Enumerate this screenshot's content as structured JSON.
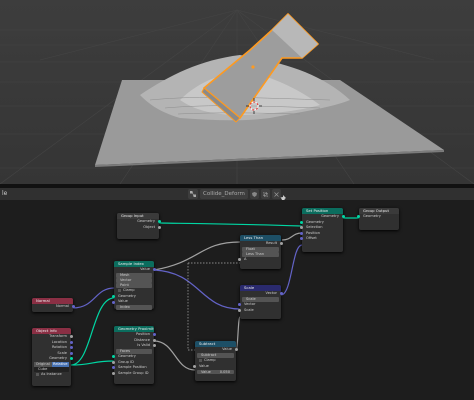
{
  "header": {
    "editor_label": "le",
    "node_group_name": "Collide_Deform"
  },
  "nodes": {
    "group_input": {
      "title": "Group Input",
      "geometry": "Geometry",
      "object": "Object"
    },
    "set_position": {
      "title": "Set Position",
      "geometry_out": "Geometry",
      "geometry_in": "Geometry",
      "selection": "Selection",
      "position": "Position",
      "offset": "Offset"
    },
    "group_output": {
      "title": "Group Output",
      "geometry": "Geometry"
    },
    "less_than": {
      "title": "Less Than",
      "result": "Result",
      "type": "Float",
      "op": "Less Than",
      "a": "A",
      "b": "B"
    },
    "sample_index": {
      "title": "Sample Index",
      "value_out": "Value",
      "type": "Mesh",
      "data": "Vector",
      "domain": "Point",
      "clamp": "Clamp",
      "geometry": "Geometry",
      "value": "Value",
      "index": "Index",
      "index_value": "0"
    },
    "normal": {
      "title": "Normal",
      "normal": "Normal"
    },
    "object_info": {
      "title": "Object Info",
      "transform": "Transform",
      "location": "Location",
      "rotation": "Rotation",
      "scale": "Scale",
      "geometry": "Geometry",
      "mode_original": "Original",
      "mode_relative": "Relative",
      "object": "Cube",
      "as_instance": "As Instance"
    },
    "geometry_proximity": {
      "title": "Geometry Proximity",
      "position": "Position",
      "distance": "Distance",
      "is_valid": "Is Valid",
      "target_mode": "Faces",
      "geometry": "Geometry",
      "group_id": "Group ID",
      "sample_position": "Sample Position",
      "sample_group_id": "Sample Group ID"
    },
    "scale": {
      "title": "Scale",
      "vector_out": "Vector",
      "type": "Scale",
      "vector": "Vector",
      "scale": "Scale"
    },
    "subtract": {
      "title": "Subtract",
      "value_out": "Value",
      "op": "Subtract",
      "clamp": "Clamp",
      "value_a": "Value",
      "value_b": "Value",
      "value_b_num": "0.050"
    }
  }
}
